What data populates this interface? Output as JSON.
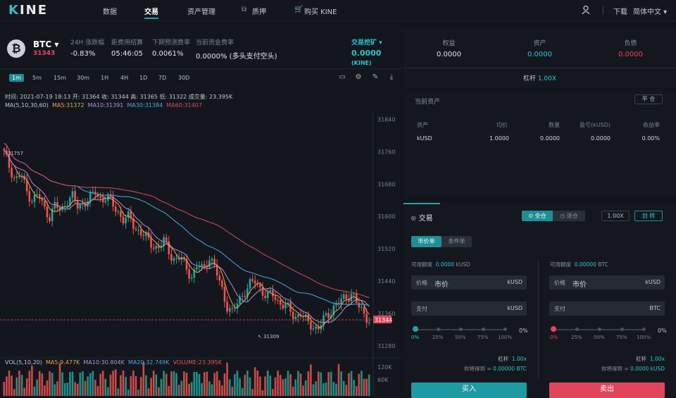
{
  "nav": {
    "logo_accent": "K",
    "logo_rest": "INE",
    "items": [
      "数据",
      "交易",
      "资产管理",
      "质押",
      "购买 KINE"
    ],
    "download": "下载",
    "language": "简体中文"
  },
  "ticker": {
    "symbol": "BTC",
    "price": "31343",
    "stats": [
      {
        "label": "24H 涨跌幅",
        "value": "-0.83%"
      },
      {
        "label": "距费用结算",
        "value": "05:46:05"
      },
      {
        "label": "下期预测费率",
        "value": "0.0061%"
      },
      {
        "label": "当前资金费率",
        "value": "0.0000% (多头支付空头)"
      }
    ],
    "mining_label": "交易挖矿",
    "mining_value": "0.0000",
    "mining_unit": "(KINE)"
  },
  "timeframes": [
    "1m",
    "5m",
    "15m",
    "30m",
    "1H",
    "4H",
    "1D",
    "7D",
    "30D"
  ],
  "chart_info": {
    "ohlc": "时间: 2021-07-19 18:13   开: 31364   收: 31344   高: 31365   低: 31322   成交量: 23.395K",
    "ma_title": "MA(5,10,30,60)",
    "ma5": "MA5:31372",
    "ma10": "MA10:31391",
    "ma30": "MA30:31384",
    "ma60": "MA60:31407",
    "vol_title": "VOL(5,10,20)",
    "vma5": "MA5:9.477K",
    "vma10": "MA10:30.804K",
    "vma20": "MA20:32.749K",
    "volume": "VOLUME:23.395K",
    "high_mark": "31757",
    "low_mark": "31309",
    "last_price": "31344"
  },
  "chart_data": {
    "type": "candlestick",
    "ylim": [
      31250,
      31860
    ],
    "y_ticks": [
      31840,
      31760,
      31680,
      31600,
      31520,
      31440,
      31360,
      31280
    ],
    "vol_ticks": [
      "120K",
      "60K"
    ],
    "closes": [
      31757,
      31720,
      31690,
      31705,
      31660,
      31640,
      31655,
      31620,
      31600,
      31630,
      31610,
      31640,
      31650,
      31620,
      31635,
      31645,
      31660,
      31640,
      31650,
      31630,
      31610,
      31590,
      31600,
      31570,
      31560,
      31545,
      31530,
      31520,
      31540,
      31510,
      31490,
      31500,
      31470,
      31450,
      31480,
      31470,
      31500,
      31470,
      31430,
      31380,
      31360,
      31390,
      31410,
      31430,
      31440,
      31420,
      31400,
      31410,
      31390,
      31380,
      31370,
      31350,
      31360,
      31340,
      31330,
      31320,
      31345,
      31360,
      31380,
      31390,
      31400,
      31410,
      31380,
      31360,
      31344
    ],
    "colors": {
      "up": "#26a69a",
      "down": "#ef5350",
      "ma5": "#e8a64c",
      "ma10": "#b48ed6",
      "ma30": "#4aa8e0",
      "ma60": "#d84a64"
    }
  },
  "summary": [
    {
      "label": "权益",
      "value": "0.0000"
    },
    {
      "label": "资产",
      "value": "0.0000"
    },
    {
      "label": "负债",
      "value": "0.0000"
    }
  ],
  "leverage": {
    "label": "杠杆",
    "value": "1.00X"
  },
  "assets": {
    "title": "当前资产",
    "close_btn": "平 仓",
    "headers": [
      "资产",
      "均价",
      "数量",
      "盈亏(kUSD)",
      "收益率"
    ],
    "row": [
      "kUSD",
      "1.0000",
      "0.0000",
      "0.0000",
      "0.00%"
    ]
  },
  "trade": {
    "title": "交易",
    "cross": "全仓",
    "isolated": "逐仓",
    "lev_btn": "1.00X",
    "transfer": "划 转",
    "market_tab": "市价单",
    "limit_tab": "条件单",
    "buy": {
      "avail_label": "可用额度",
      "avail_value": "0.0000",
      "avail_unit": "kUSD",
      "price_label": "价格",
      "price_value": "市价",
      "price_unit": "kUSD",
      "pay_label": "支付",
      "pay_unit": "kUSD",
      "pct": "0%",
      "lev_label": "杠杆",
      "lev_value": "1.00x",
      "get_label": "你将得到 ≈",
      "get_value": "0.00000 BTC",
      "button": "买入"
    },
    "sell": {
      "avail_label": "可用额度",
      "avail_value": "0.00000",
      "avail_unit": "BTC",
      "price_label": "价格",
      "price_value": "市价",
      "price_unit": "kUSD",
      "pay_label": "支付",
      "pay_unit": "BTC",
      "pct": "0%",
      "lev_label": "杠杆",
      "lev_value": "1.00x",
      "get_label": "你将得到 ≈",
      "get_value": "0.0000 kUSD",
      "button": "卖出"
    },
    "steps": [
      "0%",
      "25%",
      "50%",
      "75%",
      "100%"
    ]
  }
}
